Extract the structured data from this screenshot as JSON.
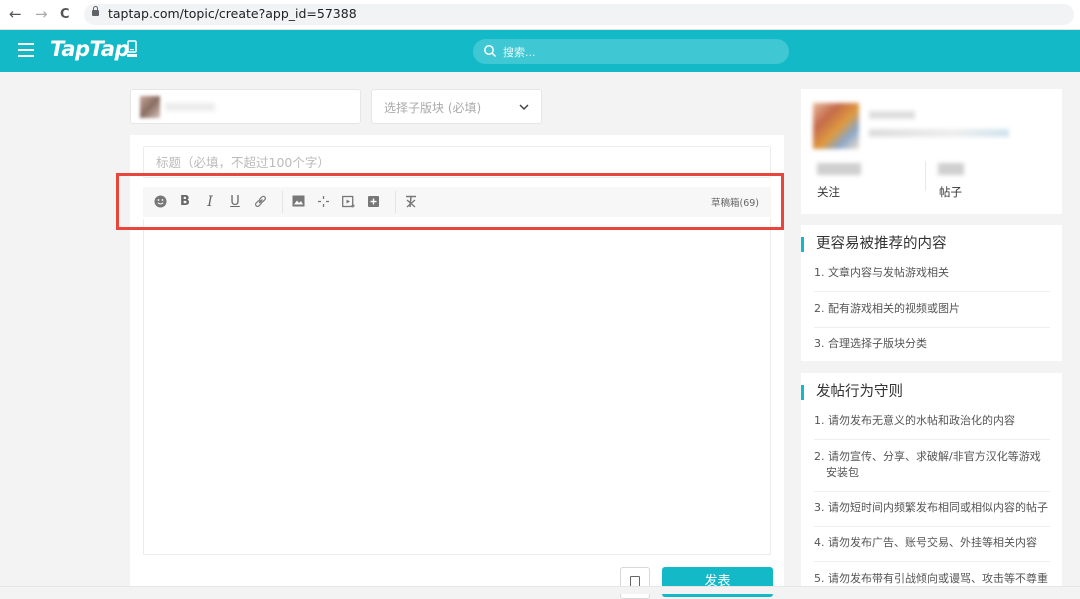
{
  "browser": {
    "back": "←",
    "forward": "→",
    "reload": "C",
    "url": "taptap.com/topic/create?app_id=57388"
  },
  "header": {
    "logo": "TapTap",
    "search_placeholder": "搜索..."
  },
  "editor": {
    "board_select_placeholder": "选择子版块 (必填)",
    "title_placeholder": "标题（必填，不超过100个字）",
    "drafts_label": "草稿箱(69)",
    "publish_label": "发表"
  },
  "profile": {
    "stat_follow_label": "关注",
    "stat_posts_label": "帖子"
  },
  "recommend": {
    "title": "更容易被推荐的内容",
    "items": [
      "1. 文章内容与发帖游戏相关",
      "2. 配有游戏相关的视频或图片",
      "3. 合理选择子版块分类"
    ]
  },
  "rules": {
    "title": "发帖行为守则",
    "items": [
      "1. 请勿发布无意义的水帖和政治化的内容",
      "2. 请勿宣传、分享、求破解/非官方汉化等游戏",
      "安装包",
      "3. 请勿短时间内频繁发布相同或相似内容的帖子",
      "4. 请勿发布广告、账号交易、外挂等相关内容",
      "5. 请勿发布带有引战倾向或谩骂、攻击等不尊重"
    ]
  },
  "colors": {
    "brand": "#14b9c8",
    "highlight": "#e8453c"
  }
}
